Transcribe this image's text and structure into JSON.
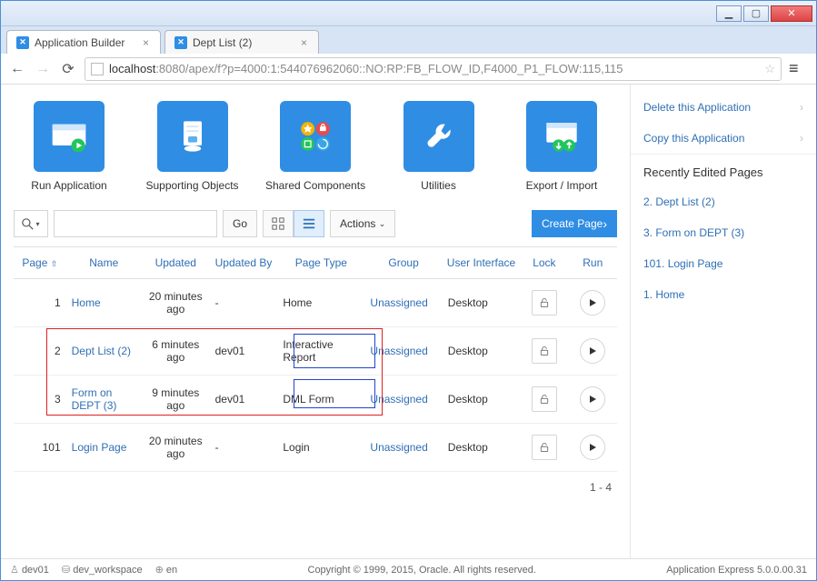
{
  "browser": {
    "tabs": [
      {
        "title": "Application Builder",
        "active": true
      },
      {
        "title": "Dept List (2)",
        "active": false
      }
    ],
    "url_host": "localhost",
    "url_port_path": ":8080/apex/f?p=4000:1:544076962060::NO:RP:FB_FLOW_ID,F4000_P1_FLOW:115,115"
  },
  "tiles": [
    {
      "label": "Run Application"
    },
    {
      "label": "Supporting Objects"
    },
    {
      "label": "Shared Components"
    },
    {
      "label": "Utilities"
    },
    {
      "label": "Export / Import"
    }
  ],
  "toolbar": {
    "go": "Go",
    "actions": "Actions",
    "create_page": "Create Page"
  },
  "columns": [
    "Page",
    "Name",
    "Updated",
    "Updated By",
    "Page Type",
    "Group",
    "User Interface",
    "Lock",
    "Run"
  ],
  "rows": [
    {
      "page": "1",
      "name": "Home",
      "updated": "20 minutes ago",
      "by": "-",
      "ptype": "Home",
      "group": "Unassigned",
      "ui": "Desktop"
    },
    {
      "page": "2",
      "name": "Dept List (2)",
      "updated": "6 minutes ago",
      "by": "dev01",
      "ptype": "Interactive Report",
      "group": "Unassigned",
      "ui": "Desktop"
    },
    {
      "page": "3",
      "name": "Form on DEPT (3)",
      "updated": "9 minutes ago",
      "by": "dev01",
      "ptype": "DML Form",
      "group": "Unassigned",
      "ui": "Desktop"
    },
    {
      "page": "101",
      "name": "Login Page",
      "updated": "20 minutes ago",
      "by": "-",
      "ptype": "Login",
      "group": "Unassigned",
      "ui": "Desktop"
    }
  ],
  "rowcount": "1 - 4",
  "side": {
    "actions": [
      "Delete this Application",
      "Copy this Application"
    ],
    "recent_header": "Recently Edited Pages",
    "recent": [
      "2. Dept List (2)",
      "3. Form on DEPT (3)",
      "101. Login Page",
      "1. Home"
    ]
  },
  "footer": {
    "user": "dev01",
    "workspace": "dev_workspace",
    "lang": "en",
    "copyright": "Copyright © 1999, 2015, Oracle. All rights reserved.",
    "version": "Application Express 5.0.0.00.31"
  }
}
